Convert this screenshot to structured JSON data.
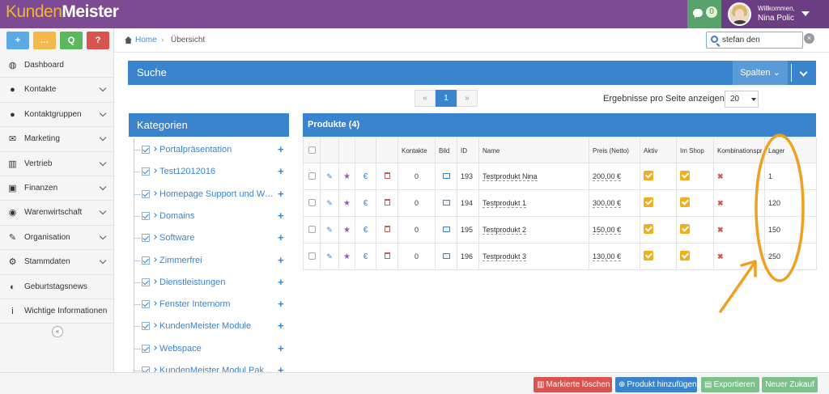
{
  "app": {
    "logo_part1": "Kunden",
    "logo_part2": "Meister"
  },
  "topbar": {
    "chat_count": "0",
    "welcome": "Willkommen,",
    "username": "Nina Polic"
  },
  "quick_buttons": [
    "+",
    "…",
    "Q",
    "?"
  ],
  "nav": [
    {
      "label": "Dashboard",
      "icon": "dashboard-icon",
      "glyph": "◍",
      "chevron": false
    },
    {
      "label": "Kontakte",
      "icon": "user-icon",
      "glyph": "●",
      "chevron": true
    },
    {
      "label": "Kontaktgruppen",
      "icon": "users-icon",
      "glyph": "●",
      "chevron": true
    },
    {
      "label": "Marketing",
      "icon": "envelope-icon",
      "glyph": "✉",
      "chevron": true
    },
    {
      "label": "Vertrieb",
      "icon": "bar-chart-icon",
      "glyph": "▥",
      "chevron": true
    },
    {
      "label": "Finanzen",
      "icon": "money-icon",
      "glyph": "▣",
      "chevron": true
    },
    {
      "label": "Warenwirtschaft",
      "icon": "globe-icon",
      "glyph": "◉",
      "chevron": true
    },
    {
      "label": "Organisation",
      "icon": "edit-icon",
      "glyph": "✎",
      "chevron": true
    },
    {
      "label": "Stammdaten",
      "icon": "cogs-icon",
      "glyph": "⚙",
      "chevron": true
    },
    {
      "label": "Geburtstagsnews",
      "icon": "adjust-icon",
      "glyph": "◐",
      "chevron": false
    },
    {
      "label": "Wichtige Informationen",
      "icon": "info-icon",
      "glyph": "i",
      "chevron": false
    }
  ],
  "collapse_label": "«",
  "breadcrumb": {
    "home": "Home",
    "separator": "›",
    "current": "Übersicht"
  },
  "search": {
    "value": "stefan den",
    "clear": "×"
  },
  "suche": {
    "title": "Suche",
    "spalten": "Spalten ⌄"
  },
  "pager": {
    "prev": "«",
    "current": "1",
    "next": "»"
  },
  "per_page": {
    "label": "Ergebnisse pro Seite anzeigen",
    "value": "20"
  },
  "kategorien": {
    "title": "Kategorien",
    "add": "+",
    "items": [
      "Portalpräsentation",
      "Test12012016",
      "Homepage Support und Wa…",
      "Domains",
      "Software",
      "Zimmerfrei",
      "Dienstleistungen",
      "Fenster Internorm",
      "KundenMeister Module",
      "Webspace",
      "KundenMeister Modul Pakete"
    ]
  },
  "produkte": {
    "title": "Produkte (4)",
    "columns": [
      "",
      "",
      "",
      "",
      "",
      "Kontakte",
      "Bild",
      "ID",
      "Name",
      "Preis (Netto)",
      "Aktiv",
      "Im Shop",
      "Kombinationspr",
      "Lager"
    ],
    "rows": [
      {
        "kontakte": "0",
        "id": "193",
        "name": "Testprodukt Nina",
        "preis": "200,00 €",
        "lager": "1"
      },
      {
        "kontakte": "0",
        "id": "194",
        "name": "Testprodukt 1",
        "preis": "300,00 €",
        "lager": "120"
      },
      {
        "kontakte": "0",
        "id": "195",
        "name": "Testprodukt 2",
        "preis": "150,00 €",
        "lager": "150"
      },
      {
        "kontakte": "0",
        "id": "196",
        "name": "Testprodukt 3",
        "preis": "130,00 €",
        "lager": "250"
      }
    ]
  },
  "bottom": {
    "delete": "Markierte löschen",
    "add": "Produkt hinzufügen",
    "export": "Exportieren",
    "new": "Neuer Zukauf"
  },
  "colors": {
    "topbar": "#7d4b94",
    "accent": "#3a83cd",
    "annotation": "#f0a020"
  }
}
